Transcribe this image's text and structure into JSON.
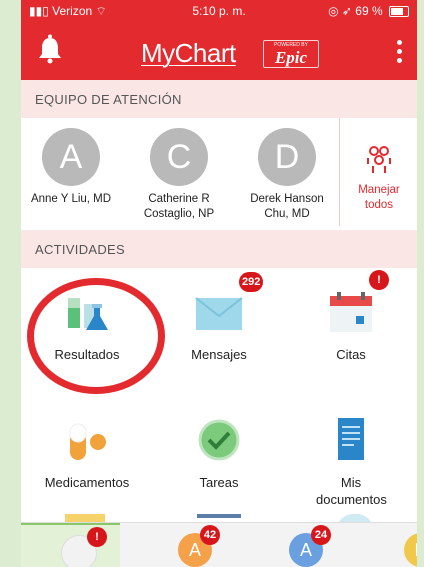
{
  "status_bar": {
    "carrier": "Verizon",
    "time": "5:10 p. m.",
    "battery": "69 %"
  },
  "header": {
    "logo_text": "MyChart",
    "powered_by": "POWERED BY",
    "epic": "Epic",
    "bell_icon": "bell-icon",
    "menu_icon": "vertical-dots-icon"
  },
  "colors": {
    "brand_red": "#e22a2f",
    "badge_red": "#d7161b",
    "section_bg": "#fbe6e6",
    "avatar_gray": "#b9b9b9"
  },
  "team": {
    "heading": "EQUIPO DE ATENCIÓN",
    "members": [
      {
        "initial": "A",
        "name": "Anne Y Liu, MD"
      },
      {
        "initial": "C",
        "name": "Catherine R Costaglio, NP"
      },
      {
        "initial": "D",
        "name": "Derek Hanson Chu, MD"
      }
    ],
    "manage_label": "Manejar todos"
  },
  "activities": {
    "heading": "ACTIVIDADES",
    "items": [
      {
        "label": "Resultados",
        "icon": "lab-flasks-icon",
        "badge": ""
      },
      {
        "label": "Mensajes",
        "icon": "envelope-icon",
        "badge": "292"
      },
      {
        "label": "Citas",
        "icon": "calendar-icon",
        "badge": "!"
      },
      {
        "label": "Medicamentos",
        "icon": "pills-icon",
        "badge": ""
      },
      {
        "label": "Tareas",
        "icon": "checkmark-icon",
        "badge": ""
      },
      {
        "label": "Mis documentos",
        "icon": "document-icon",
        "badge": ""
      }
    ]
  },
  "bottom_tabs": [
    {
      "initial": "",
      "badge": "!",
      "color": "#f2f2f2"
    },
    {
      "initial": "A",
      "badge": "42",
      "color": "#f4a14a"
    },
    {
      "initial": "A",
      "badge": "24",
      "color": "#6a9fe0"
    },
    {
      "initial": "D",
      "badge": "",
      "color": "#f2c84b"
    }
  ]
}
